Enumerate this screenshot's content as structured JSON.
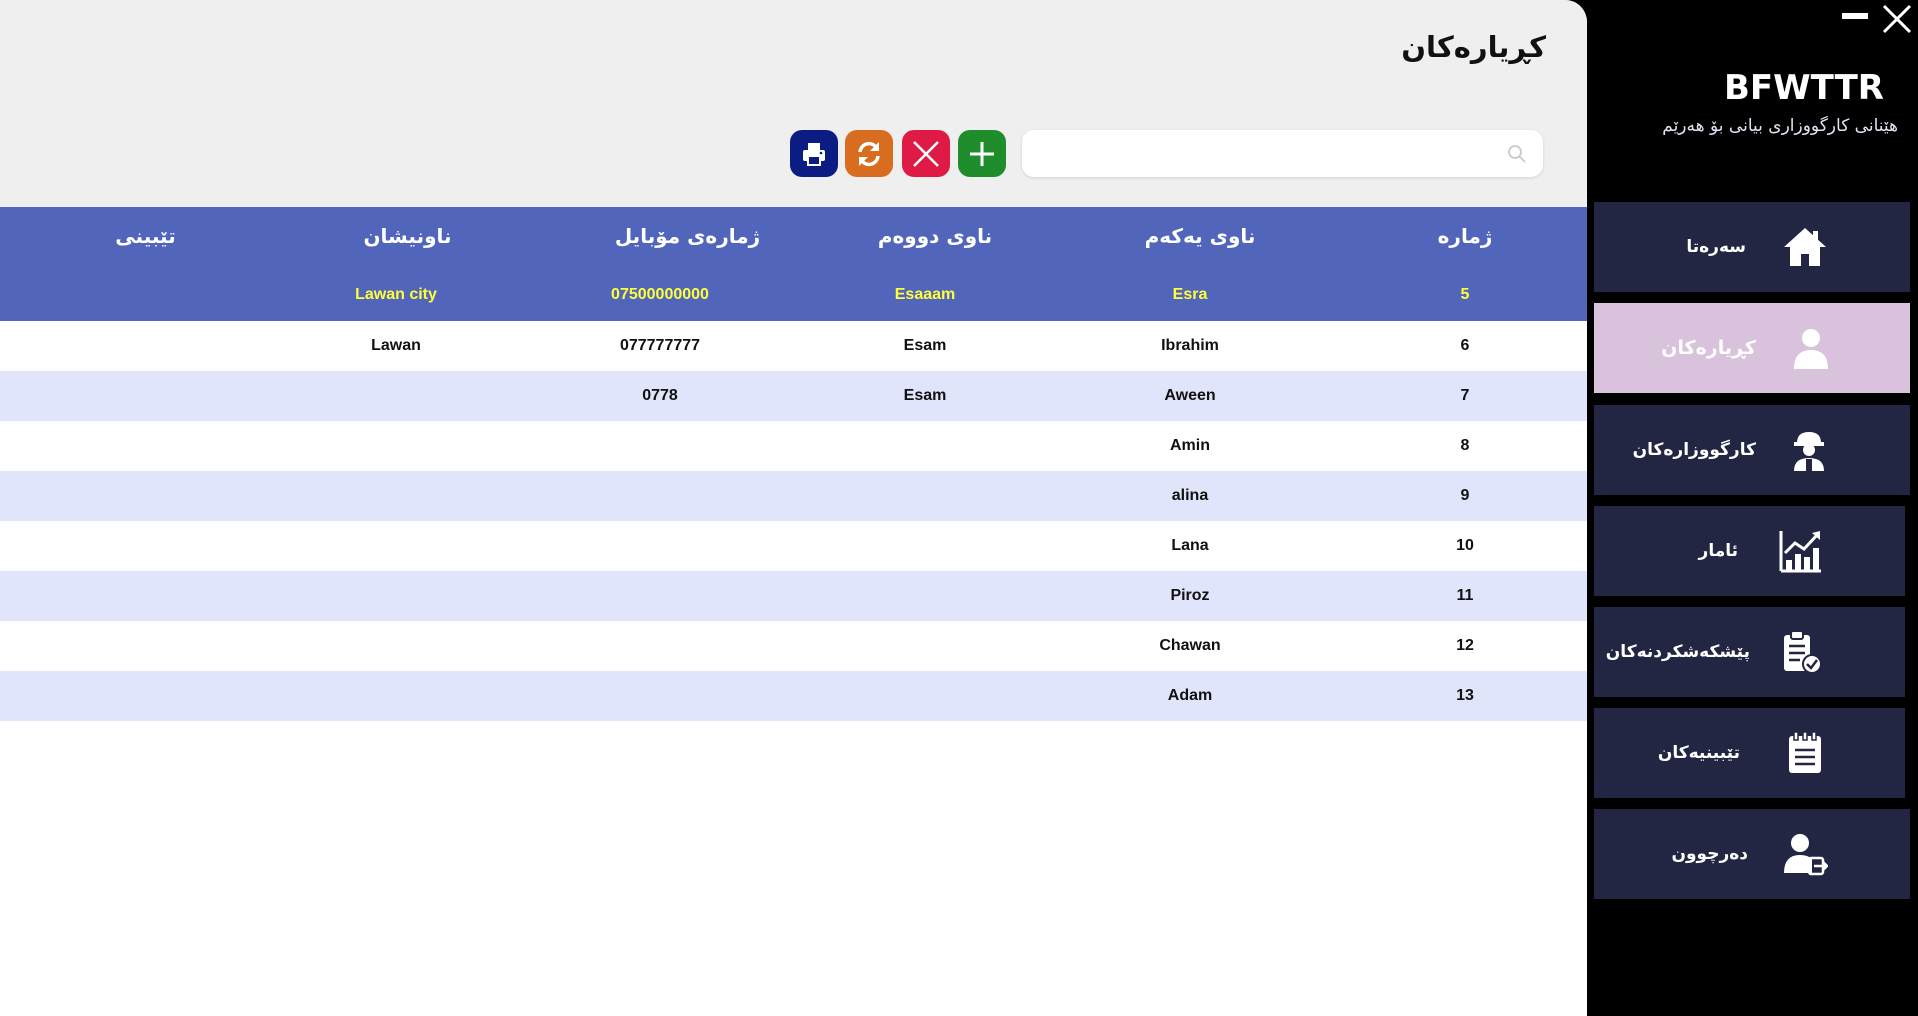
{
  "app": {
    "brand_title": "BFWTTR",
    "brand_subtitle": "هێنانی کارگووزاری بیانی بۆ هەرێم"
  },
  "page": {
    "title": "کڕیارەکان",
    "search": {
      "value": "",
      "placeholder": ""
    }
  },
  "toolbar": {
    "buttons": [
      {
        "name": "print",
        "icon": "printer-icon",
        "color": "#0b1d83"
      },
      {
        "name": "refresh",
        "icon": "refresh-icon",
        "color": "#d96d1f"
      },
      {
        "name": "delete",
        "icon": "close-icon",
        "color": "#de1a45"
      },
      {
        "name": "add",
        "icon": "plus-icon",
        "color": "#1f8d2b"
      }
    ]
  },
  "table": {
    "headers": {
      "number": "ژمارە",
      "first_name": "ناوی یەکەم",
      "second_name": "ناوی دووەم",
      "mobile": "ژمارەی مۆبایل",
      "address": "ناونیشان",
      "note": "تێبینی"
    },
    "selected_row": 0,
    "rows": [
      {
        "number": "5",
        "first_name": "Esra",
        "second_name": "Esaaam",
        "mobile": "07500000000",
        "address": "Lawan city",
        "note": ""
      },
      {
        "number": "6",
        "first_name": "Ibrahim",
        "second_name": "Esam",
        "mobile": "077777777",
        "address": "Lawan",
        "note": ""
      },
      {
        "number": "7",
        "first_name": "Aween",
        "second_name": "Esam",
        "mobile": "0778",
        "address": "",
        "note": ""
      },
      {
        "number": "8",
        "first_name": "Amin",
        "second_name": "",
        "mobile": "",
        "address": "",
        "note": ""
      },
      {
        "number": "9",
        "first_name": "alina",
        "second_name": "",
        "mobile": "",
        "address": "",
        "note": ""
      },
      {
        "number": "10",
        "first_name": "Lana",
        "second_name": "",
        "mobile": "",
        "address": "",
        "note": ""
      },
      {
        "number": "11",
        "first_name": "Piroz",
        "second_name": "",
        "mobile": "",
        "address": "",
        "note": ""
      },
      {
        "number": "12",
        "first_name": "Chawan",
        "second_name": "",
        "mobile": "",
        "address": "",
        "note": ""
      },
      {
        "number": "13",
        "first_name": "Adam",
        "second_name": "",
        "mobile": "",
        "address": "",
        "note": ""
      }
    ],
    "colors": {
      "header": "#5165bb",
      "selected_text": "#ffff3a",
      "odd_row": "#e0e5fb"
    }
  },
  "sidebar": {
    "items": [
      {
        "label": "سەرەتا",
        "icon": "home-icon",
        "active": false
      },
      {
        "label": "کڕیارەکان",
        "icon": "user-icon",
        "active": true
      },
      {
        "label": "کارگووزارەکان",
        "icon": "worker-icon",
        "active": false
      },
      {
        "label": "ئامار",
        "icon": "chart-icon",
        "active": false
      },
      {
        "label": "پێشکەشکردنەکان",
        "icon": "clipboard-check-icon",
        "active": false
      },
      {
        "label": "تێبینیەکان",
        "icon": "notepad-icon",
        "active": false
      },
      {
        "label": "دەرچوون",
        "icon": "logout-user-icon",
        "active": false
      }
    ],
    "colors": {
      "item": "#222642",
      "active_item": "#d8c2dc"
    }
  }
}
